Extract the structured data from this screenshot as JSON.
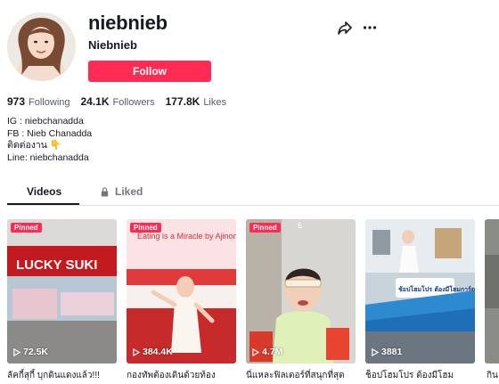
{
  "profile": {
    "username": "niebnieb",
    "nickname": "Niebnieb",
    "follow_label": "Follow"
  },
  "stats": [
    {
      "value": "973",
      "label": "Following"
    },
    {
      "value": "24.1K",
      "label": "Followers"
    },
    {
      "value": "177.8K",
      "label": "Likes"
    }
  ],
  "bio": [
    "IG : niebchanadda",
    "FB : Nieb Chanadda",
    "ติดต่องาน 👇",
    "Line: niebchanadda"
  ],
  "tabs": [
    {
      "label": "Videos",
      "active": true
    },
    {
      "label": "Liked",
      "active": false,
      "icon": "lock-icon"
    }
  ],
  "videos": [
    {
      "pinned": "Pinned",
      "views": "72.5K",
      "caption": "ลัคกี้สุกี้ บุกดินแดงแล้ว!!!",
      "overlay": "LUCKY SUKI"
    },
    {
      "pinned": "Pinned",
      "views": "384.4K",
      "caption": "กองทัพต้องเดินด้วยท้อง",
      "overlay": "Eating is a Miracle by Ajinomoto"
    },
    {
      "pinned": "Pinned",
      "views": "4.7M",
      "caption": "นี่แหละฟิลเตอร์ที่สนุกที่สุด",
      "overlay": "6"
    },
    {
      "pinned": "",
      "views": "3881",
      "caption": "ช็อปโฮมโปร ต้องมีโฮม",
      "overlay": "ช้อปโฮมโปร ต้องมีโฮมการ์ด!"
    },
    {
      "pinned": "",
      "views": "",
      "caption": "กิน",
      "overlay": ""
    }
  ],
  "colors": {
    "accent": "#fe2c55",
    "text": "#161823",
    "muted": "#73757c"
  }
}
